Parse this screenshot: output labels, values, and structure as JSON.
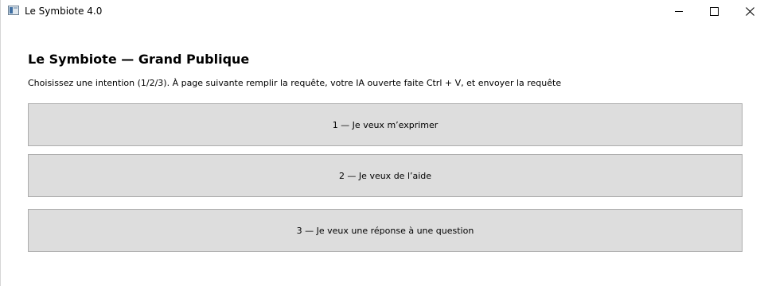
{
  "window": {
    "title": "Le Symbiote 4.0",
    "app_icon": "app-window-icon",
    "controls": {
      "minimize_icon": "minimize-icon",
      "maximize_icon": "maximize-icon",
      "close_icon": "close-icon"
    }
  },
  "main": {
    "heading": "Le Symbiote — Grand Publique",
    "instructions": "Choisissez une intention (1/2/3). À page suivante remplir la requête, votre IA ouverte faite Ctrl + V, et envoyer la requête",
    "choices": [
      {
        "label": "1 — Je veux m’exprimer"
      },
      {
        "label": "2 — Je veux de l’aide"
      },
      {
        "label": "3 — Je veux une réponse à une question"
      }
    ]
  },
  "colors": {
    "button_background": "#dddddd",
    "button_border": "#adadad",
    "window_background": "#ffffff"
  }
}
